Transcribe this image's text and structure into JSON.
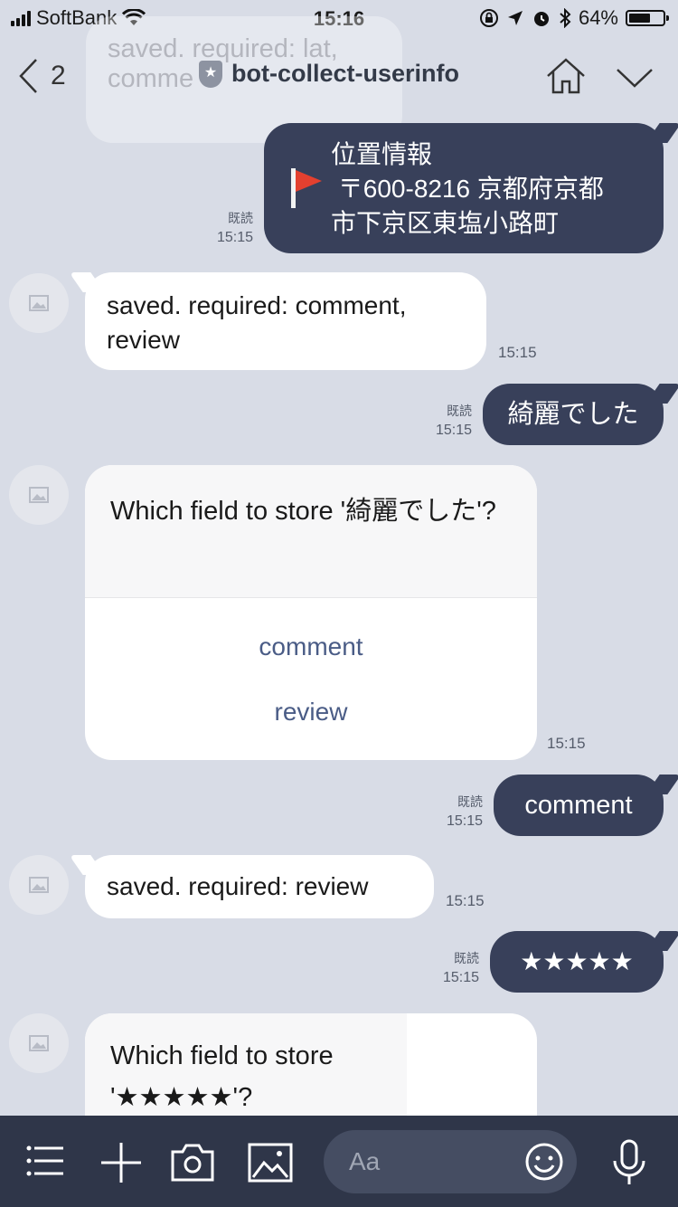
{
  "status_bar": {
    "carrier": "SoftBank",
    "time": "15:16",
    "battery": "64%",
    "battery_level": 0.64
  },
  "header": {
    "back_count": "2",
    "title": "bot-collect-userinfo",
    "ghost_text": "saved. required: lat, comme"
  },
  "messages": {
    "m1": {
      "line1": "位置情報",
      "line2": " 〒600-8216 京都府京都",
      "line3": "市下京区東塩小路町",
      "read": "既読",
      "time": "15:15"
    },
    "m2": {
      "text": "saved. required: comment, review",
      "time": "15:15"
    },
    "m3": {
      "text": "綺麗でした",
      "read": "既読",
      "time": "15:15"
    },
    "m4": {
      "question": "Which field to store '綺麗でした'?",
      "options": [
        "comment",
        "review"
      ],
      "time": "15:15"
    },
    "m5": {
      "text": "comment",
      "read": "既読",
      "time": "15:15"
    },
    "m6": {
      "text": "saved. required: review",
      "time": "15:15"
    },
    "m7": {
      "text": "★★★★★",
      "read": "既読",
      "time": "15:15"
    },
    "m8": {
      "question": "Which field to store '★★★★★'?"
    }
  },
  "input": {
    "placeholder": "Aa"
  }
}
